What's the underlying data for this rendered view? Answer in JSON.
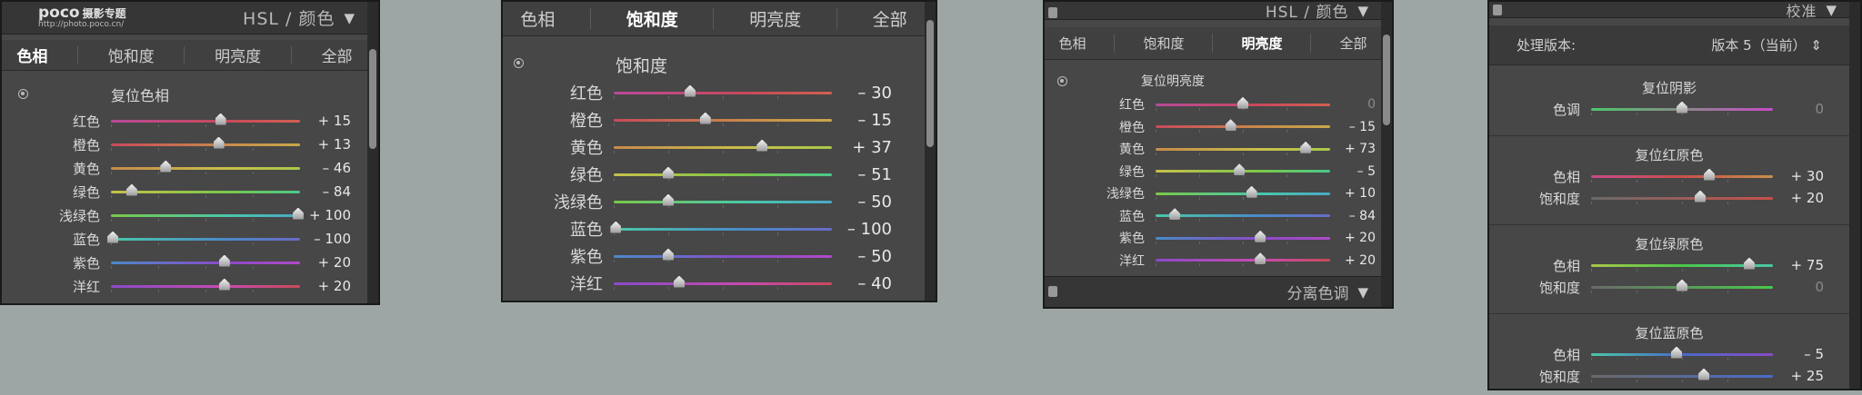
{
  "panel1": {
    "title": "HSL / 颜色",
    "logo_main": "poco",
    "logo_sub": "摄影专题",
    "logo_url": "http://photo.poco.cn/",
    "tabs": [
      "色相",
      "饱和度",
      "明亮度",
      "全部"
    ],
    "active_tab": 0,
    "reset_label": "复位色相",
    "sliders": [
      {
        "label": "红色",
        "value": "+ 15",
        "pos": 0.58
      },
      {
        "label": "橙色",
        "value": "+ 13",
        "pos": 0.57
      },
      {
        "label": "黄色",
        "value": "– 46",
        "pos": 0.29
      },
      {
        "label": "绿色",
        "value": "– 84",
        "pos": 0.11
      },
      {
        "label": "浅绿色",
        "value": "+ 100",
        "pos": 0.99
      },
      {
        "label": "蓝色",
        "value": "– 100",
        "pos": 0.01
      },
      {
        "label": "紫色",
        "value": "+ 20",
        "pos": 0.6
      },
      {
        "label": "洋红",
        "value": "+ 20",
        "pos": 0.6
      }
    ]
  },
  "panel2": {
    "tabs": [
      "色相",
      "饱和度",
      "明亮度",
      "全部"
    ],
    "active_tab": 1,
    "reset_label": "饱和度",
    "sliders": [
      {
        "label": "红色",
        "value": "– 30",
        "pos": 0.35
      },
      {
        "label": "橙色",
        "value": "– 15",
        "pos": 0.42
      },
      {
        "label": "黄色",
        "value": "+ 37",
        "pos": 0.68
      },
      {
        "label": "绿色",
        "value": "– 51",
        "pos": 0.25
      },
      {
        "label": "浅绿色",
        "value": "– 50",
        "pos": 0.25
      },
      {
        "label": "蓝色",
        "value": "– 100",
        "pos": 0.01
      },
      {
        "label": "紫色",
        "value": "– 50",
        "pos": 0.25
      },
      {
        "label": "洋红",
        "value": "– 40",
        "pos": 0.3
      }
    ]
  },
  "panel3": {
    "title": "HSL / 颜色",
    "tabs": [
      "色相",
      "饱和度",
      "明亮度",
      "全部"
    ],
    "active_tab": 2,
    "reset_label": "复位明亮度",
    "sliders": [
      {
        "label": "红色",
        "value": "0",
        "pos": 0.5,
        "dim": true
      },
      {
        "label": "橙色",
        "value": "– 15",
        "pos": 0.43
      },
      {
        "label": "黄色",
        "value": "+ 73",
        "pos": 0.86
      },
      {
        "label": "绿色",
        "value": "– 5",
        "pos": 0.48
      },
      {
        "label": "浅绿色",
        "value": "+ 10",
        "pos": 0.55
      },
      {
        "label": "蓝色",
        "value": "– 84",
        "pos": 0.11
      },
      {
        "label": "紫色",
        "value": "+ 20",
        "pos": 0.6
      },
      {
        "label": "洋红",
        "value": "+ 20",
        "pos": 0.6
      }
    ],
    "footer_title": "分离色调"
  },
  "panel4": {
    "title": "校准",
    "process_label": "处理版本:",
    "process_value": "版本 5（当前）",
    "shadow": {
      "title": "复位阴影",
      "rows": [
        {
          "label": "色调",
          "value": "0",
          "pos": 0.5,
          "dim": true
        }
      ]
    },
    "red": {
      "title": "复位红原色",
      "rows": [
        {
          "label": "色相",
          "value": "+ 30",
          "pos": 0.65
        },
        {
          "label": "饱和度",
          "value": "+ 20",
          "pos": 0.6
        }
      ]
    },
    "green": {
      "title": "复位绿原色",
      "rows": [
        {
          "label": "色相",
          "value": "+ 75",
          "pos": 0.87
        },
        {
          "label": "饱和度",
          "value": "0",
          "pos": 0.5,
          "dim": true
        }
      ]
    },
    "blue": {
      "title": "复位蓝原色",
      "rows": [
        {
          "label": "色相",
          "value": "– 5",
          "pos": 0.47
        },
        {
          "label": "饱和度",
          "value": "+ 25",
          "pos": 0.62
        }
      ]
    }
  },
  "colors": {
    "red": "#c84a5a",
    "orange": "#c88a4a",
    "yellow": "#c8c04a",
    "green": "#7ac84a",
    "aqua": "#4ac8a8",
    "blue": "#4a8ac8",
    "purple": "#8a4ac8",
    "magenta": "#c84ab0"
  }
}
